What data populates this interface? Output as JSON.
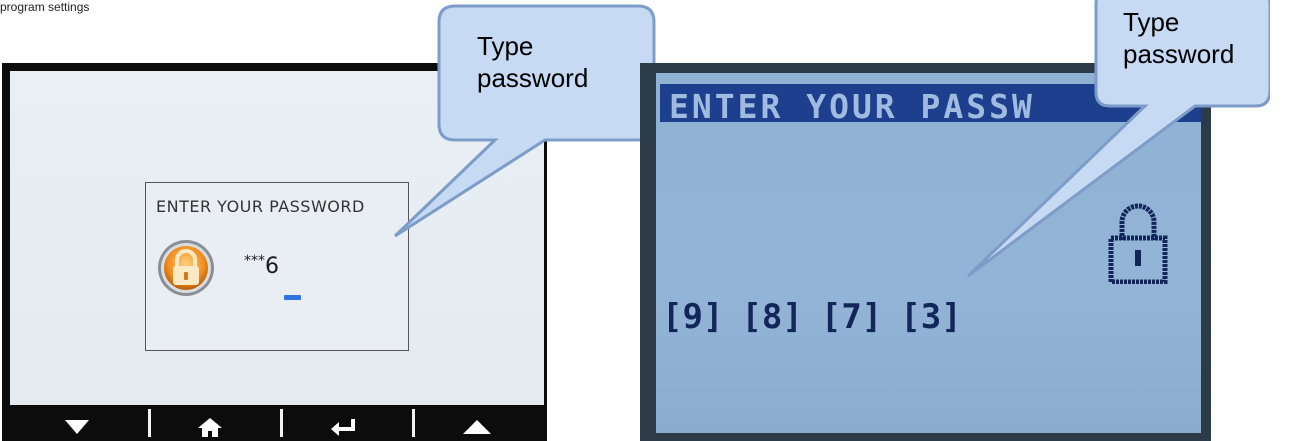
{
  "page": {
    "caption": "program settings"
  },
  "left_panel": {
    "prompt": "ENTER YOUR PASSWORD",
    "masked": "***",
    "last_digit": "6",
    "softkeys": [
      {
        "icon": "arrow-down-icon",
        "glyph": "▼"
      },
      {
        "icon": "home-icon",
        "glyph": "⌂"
      },
      {
        "icon": "enter-icon",
        "glyph": "↵"
      },
      {
        "icon": "arrow-up-icon",
        "glyph": "▲"
      }
    ],
    "callout": {
      "line1": "Type",
      "line2": "password"
    }
  },
  "right_panel": {
    "header": "ENTER YOUR PASSW",
    "digits": [
      "[9]",
      "[8]",
      "[7]",
      "[3]"
    ],
    "active_digit_index": 3,
    "callout": {
      "line1": "Type",
      "line2": "password"
    }
  },
  "colors": {
    "callout_fill": "#c6daf3",
    "callout_stroke": "#7d9cc8",
    "lcd_blue": "#8fb1d4",
    "header_navy": "#1d3f8e",
    "cursor_blue": "#2b74e2"
  }
}
